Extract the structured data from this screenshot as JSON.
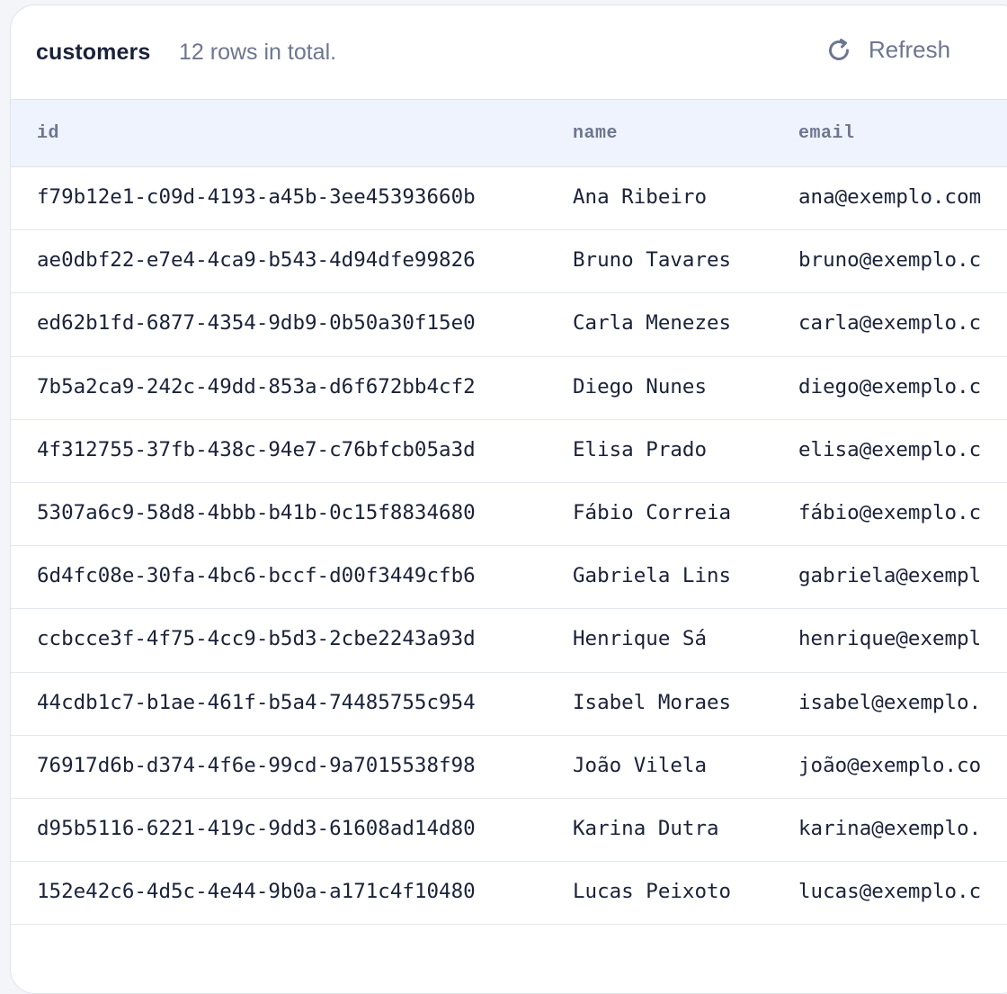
{
  "header": {
    "table_name": "customers",
    "row_count_text": "12 rows in total.",
    "refresh_label": "Refresh",
    "refresh_icon": "refresh-icon"
  },
  "columns": [
    "id",
    "name",
    "email"
  ],
  "rows": [
    {
      "id": "f79b12e1-c09d-4193-a45b-3ee45393660b",
      "name": "Ana Ribeiro",
      "email": "ana@exemplo.com"
    },
    {
      "id": "ae0dbf22-e7e4-4ca9-b543-4d94dfe99826",
      "name": "Bruno Tavares",
      "email": "bruno@exemplo.c"
    },
    {
      "id": "ed62b1fd-6877-4354-9db9-0b50a30f15e0",
      "name": "Carla Menezes",
      "email": "carla@exemplo.c"
    },
    {
      "id": "7b5a2ca9-242c-49dd-853a-d6f672bb4cf2",
      "name": "Diego Nunes",
      "email": "diego@exemplo.c"
    },
    {
      "id": "4f312755-37fb-438c-94e7-c76bfcb05a3d",
      "name": "Elisa Prado",
      "email": "elisa@exemplo.c"
    },
    {
      "id": "5307a6c9-58d8-4bbb-b41b-0c15f8834680",
      "name": "Fábio Correia",
      "email": "fábio@exemplo.c"
    },
    {
      "id": "6d4fc08e-30fa-4bc6-bccf-d00f3449cfb6",
      "name": "Gabriela Lins",
      "email": "gabriela@exempl"
    },
    {
      "id": "ccbcce3f-4f75-4cc9-b5d3-2cbe2243a93d",
      "name": "Henrique Sá",
      "email": "henrique@exempl"
    },
    {
      "id": "44cdb1c7-b1ae-461f-b5a4-74485755c954",
      "name": "Isabel Moraes",
      "email": "isabel@exemplo."
    },
    {
      "id": "76917d6b-d374-4f6e-99cd-9a7015538f98",
      "name": "João Vilela",
      "email": "joão@exemplo.co"
    },
    {
      "id": "d95b5116-6221-419c-9dd3-61608ad14d80",
      "name": "Karina Dutra",
      "email": "karina@exemplo."
    },
    {
      "id": "152e42c6-4d5c-4e44-9b0a-a171c4f10480",
      "name": "Lucas Peixoto",
      "email": "lucas@exemplo.c"
    }
  ],
  "colors": {
    "text_primary": "#1a2238",
    "text_muted": "#6d7690",
    "header_bg": "#eef3fd",
    "border": "#dfe3ec"
  }
}
